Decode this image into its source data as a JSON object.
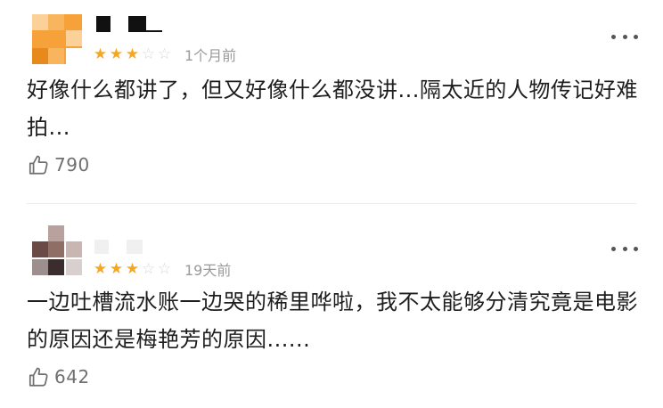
{
  "comments": [
    {
      "avatar_colors": {
        "main": "#f6a13a",
        "light": "#fbd199",
        "dark": "#e8891d"
      },
      "rating": {
        "filled": 3,
        "total": 5
      },
      "time": "1个月前",
      "content": "好像什么都讲了，但又好像什么都没讲...隔太近的人物传记好难拍...",
      "likes": "790",
      "icons": {
        "like": "thumb-up-icon",
        "more": "more-dots-icon"
      }
    },
    {
      "avatar_colors": {
        "main": "#6b4a46",
        "light": "#b9a19d",
        "dark": "#3a2d2d"
      },
      "rating": {
        "filled": 3,
        "total": 5
      },
      "time": "19天前",
      "content": "一边吐槽流水账一边哭的稀里哗啦，我不太能够分清究竟是电影的原因还是梅艳芳的原因......",
      "likes": "642",
      "icons": {
        "like": "thumb-up-icon",
        "more": "more-dots-icon"
      }
    }
  ],
  "theme": {
    "star_color": "#f5a623",
    "star_empty_color": "#d6d6d6",
    "meta_color": "#9a9a9a",
    "text_color": "#1e1e1e"
  }
}
